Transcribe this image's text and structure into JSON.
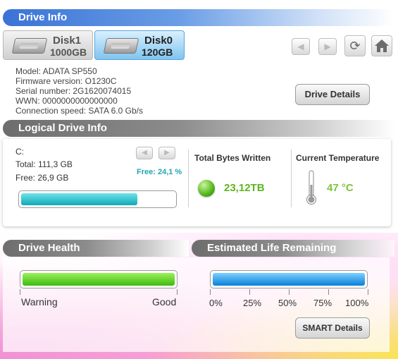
{
  "header": {
    "title": "Drive Info"
  },
  "disks": [
    {
      "name": "Disk1",
      "size": "1000GB",
      "active": false
    },
    {
      "name": "Disk0",
      "size": "120GB",
      "active": true
    }
  ],
  "nav": {
    "prev_icon": "arrow-left-icon",
    "next_icon": "arrow-right-icon",
    "refresh_icon": "refresh-icon",
    "home_icon": "home-icon"
  },
  "drive": {
    "model": "Model: ADATA SP550",
    "firmware": "Firmware version: O1230C",
    "serial": "Serial number: 2G1620074015",
    "wwn": "WWN: 0000000000000000",
    "speed": "Connection speed: SATA 6.0 Gb/s",
    "details_button": "Drive Details"
  },
  "logical": {
    "title": "Logical Drive Info",
    "drive_letter": "C:",
    "total": "Total: 111,3 GB",
    "free": "Free: 26,9 GB",
    "free_percent": "Free: 24,1 %",
    "used_fraction": 0.759,
    "tbw_label": "Total Bytes Written",
    "tbw_value": "23,12TB",
    "temp_label": "Current Temperature",
    "temp_value": "47 °C"
  },
  "health": {
    "title": "Drive Health",
    "warning_label": "Warning",
    "good_label": "Good",
    "level": 1.0
  },
  "life": {
    "title": "Estimated Life Remaining",
    "ticks": [
      "0%",
      "25%",
      "50%",
      "75%",
      "100%"
    ],
    "level": 1.0,
    "smart_button": "SMART Details"
  },
  "colors": {
    "accent_blue": "#3a73d6",
    "health_green": "#4cc61c",
    "life_blue": "#1a8fe0",
    "usage_teal": "#14b4c0",
    "value_green": "#5fb41f"
  }
}
